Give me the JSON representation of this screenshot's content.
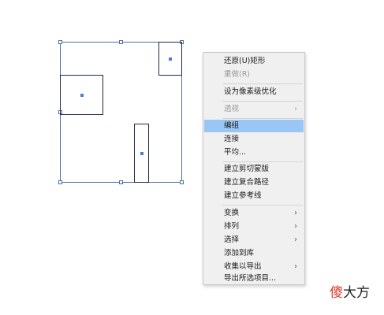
{
  "context_menu": {
    "items": [
      {
        "label": "还原(U)矩形",
        "disabled": false,
        "submenu": false,
        "highlighted": false
      },
      {
        "label": "重做(R)",
        "disabled": true,
        "submenu": false,
        "highlighted": false
      },
      {
        "label": "设为像素级优化",
        "disabled": false,
        "submenu": false,
        "highlighted": false
      },
      {
        "label": "透视",
        "disabled": true,
        "submenu": true,
        "highlighted": false
      },
      {
        "label": "编组",
        "disabled": false,
        "submenu": false,
        "highlighted": true
      },
      {
        "label": "连接",
        "disabled": false,
        "submenu": false,
        "highlighted": false
      },
      {
        "label": "平均...",
        "disabled": false,
        "submenu": false,
        "highlighted": false
      },
      {
        "label": "建立剪切蒙版",
        "disabled": false,
        "submenu": false,
        "highlighted": false
      },
      {
        "label": "建立复合路径",
        "disabled": false,
        "submenu": false,
        "highlighted": false
      },
      {
        "label": "建立参考线",
        "disabled": false,
        "submenu": false,
        "highlighted": false
      },
      {
        "label": "变换",
        "disabled": false,
        "submenu": true,
        "highlighted": false
      },
      {
        "label": "排列",
        "disabled": false,
        "submenu": true,
        "highlighted": false
      },
      {
        "label": "选择",
        "disabled": false,
        "submenu": true,
        "highlighted": false
      },
      {
        "label": "添加到库",
        "disabled": false,
        "submenu": false,
        "highlighted": false
      },
      {
        "label": "收集以导出",
        "disabled": false,
        "submenu": true,
        "highlighted": false
      },
      {
        "label": "导出所选项目...",
        "disabled": false,
        "submenu": false,
        "highlighted": false
      }
    ],
    "submenu_arrow": "›"
  },
  "watermark": {
    "first_char": "傻",
    "rest": "大方"
  },
  "colors": {
    "selection": "#4a6fa5",
    "highlight": "#99c6f5",
    "watermark_accent": "#d93a2b"
  }
}
